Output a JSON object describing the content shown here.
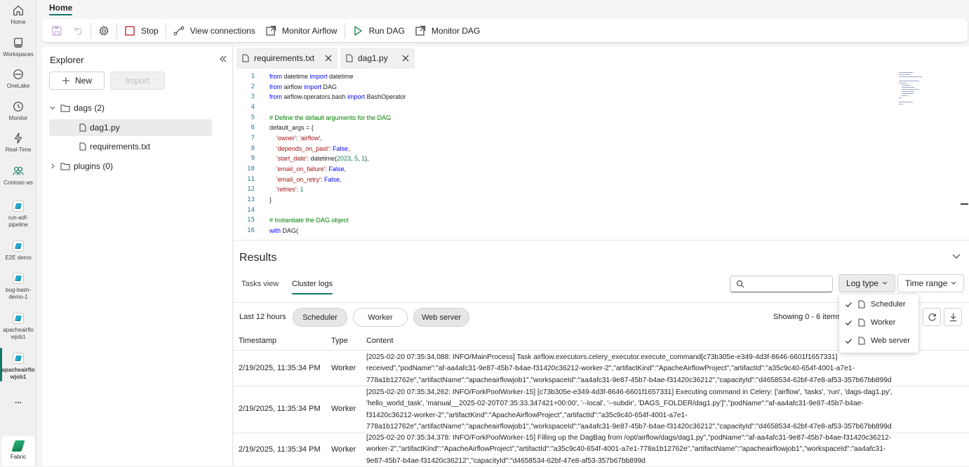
{
  "rail": {
    "items": [
      {
        "label": "Home",
        "icon": "home-icon"
      },
      {
        "label": "Workspaces",
        "icon": "workspaces-icon"
      },
      {
        "label": "OneLake",
        "icon": "onelake-icon"
      },
      {
        "label": "Monitor",
        "icon": "monitor-icon"
      },
      {
        "label": "Real-Time",
        "icon": "realtime-icon"
      },
      {
        "label": "Contoso ws",
        "icon": "workspace-group-icon"
      }
    ],
    "workspaces": [
      {
        "line1": "run-adf-",
        "line2": "pipeline"
      },
      {
        "line1": "E2E demo",
        "line2": ""
      },
      {
        "line1": "bug-bash-",
        "line2": "demo-1"
      },
      {
        "line1": "apacheairflo",
        "line2": "wjob1"
      },
      {
        "line1": "apacheairflo",
        "line2": "wjob1"
      }
    ],
    "more": "...",
    "fabric": "Fabric"
  },
  "header": {
    "home_tab": "Home"
  },
  "toolbar": {
    "stop": "Stop",
    "view_connections": "View connections",
    "monitor_airflow": "Monitor Airflow",
    "run_dag": "Run DAG",
    "monitor_dag": "Monitor DAG"
  },
  "explorer": {
    "title": "Explorer",
    "new": "New",
    "import": "Import",
    "tree": [
      {
        "label": "dags (2)"
      },
      {
        "label": "dag1.py"
      },
      {
        "label": "requirements.txt"
      },
      {
        "label": "plugins (0)"
      }
    ]
  },
  "editor": {
    "tabs": [
      {
        "label": "requirements.txt"
      },
      {
        "label": "dag1.py"
      }
    ],
    "lines": [
      "from datetime import datetime",
      "from airflow import DAG",
      "from airflow.operators.bash import BashOperator",
      "",
      "# Define the default arguments for the DAG",
      "default_args = {",
      "    'owner': 'airflow',",
      "    'depends_on_past': False,",
      "    'start_date': datetime(2023, 5, 1),",
      "    'email_on_failure': False,",
      "    'email_on_retry': False,",
      "    'retries': 1",
      "}",
      "",
      "# Instantiate the DAG object",
      "with DAG("
    ]
  },
  "results": {
    "title": "Results",
    "tabs": [
      {
        "label": "Tasks view"
      },
      {
        "label": "Cluster logs"
      }
    ],
    "log_type": "Log type",
    "time_range": "Time range",
    "filter_label": "Last 12 hours",
    "pills": [
      {
        "label": "Scheduler"
      },
      {
        "label": "Worker"
      },
      {
        "label": "Web server"
      }
    ],
    "showing": "Showing 0 - 6 items",
    "columns": {
      "timestamp": "Timestamp",
      "type": "Type",
      "content": "Content"
    },
    "rows": [
      {
        "timestamp": "2/19/2025, 11:35:34 PM",
        "type": "Worker",
        "lines": [
          "[2025-02-20 07:35:34,088: INFO/MainProcess] Task airflow.executors.celery_executor.execute_command[c73b305e-e349-4d3f-8646-6601f1657331]",
          "received\",\"podName\":\"af-aa4afc31-9e87-45b7-b4ae-f31420c36212-worker-2\",\"artifactKind\":\"ApacheAirflowProject\",\"artifactId\":\"a35c9c40-654f-4001-a7e1-",
          "778a1b12762e\",\"artifactName\":\"apacheairflowjob1\",\"workspaceId\":\"aa4afc31-9e87-45b7-b4ae-f31420c36212\",\"capacityId\":\"d4658534-62bf-47e8-af53-357b67bb899d"
        ]
      },
      {
        "timestamp": "2/19/2025, 11:35:34 PM",
        "type": "Worker",
        "lines": [
          "[2025-02-20 07:35:34,262: INFO/ForkPoolWorker-15] [c73b305e-e349-4d3f-8646-6601f1657331] Executing command in Celery: ['airflow', 'tasks', 'run', 'dags-dag1.py',",
          "'hello_world_task', 'manual__2025-02-20T07:35:33.347421+00:00', '--local', '--subdir', 'DAGS_FOLDER/dag1.py']\",\"podName\":\"af-aa4afc31-9e87-45b7-b4ae-",
          "f31420c36212-worker-2\",\"artifactKind\":\"ApacheAirflowProject\",\"artifactId\":\"a35c9c40-654f-4001-a7e1-",
          "778a1b12762e\",\"artifactName\":\"apacheairflowjob1\",\"workspaceId\":\"aa4afc31-9e87-45b7-b4ae-f31420c36212\",\"capacityId\":\"d4658534-62bf-47e8-af53-357b67bb899d"
        ]
      },
      {
        "timestamp": "2/19/2025, 11:35:34 PM",
        "type": "Worker",
        "lines": [
          "[2025-02-20 07:35:34,378: INFO/ForkPoolWorker-15] Filling up the DagBag from /opt/airflow/dags/dag1.py\",\"podName\":\"af-aa4afc31-9e87-45b7-b4ae-f31420c36212-",
          "worker-2\",\"artifactKind\":\"ApacheAirflowProject\",\"artifactId\":\"a35c9c40-654f-4001-a7e1-778a1b12762e\",\"artifactName\":\"apacheairflowjob1\",\"workspaceId\":\"aa4afc31-",
          "9e87-45b7-b4ae-f31420c36212\",\"capacityId\":\"d4658534-62bf-47e8-af53-357b67bb899d"
        ]
      }
    ],
    "log_type_menu": [
      {
        "label": "Scheduler",
        "checked": true
      },
      {
        "label": "Worker",
        "checked": true
      },
      {
        "label": "Web server",
        "checked": true
      }
    ]
  },
  "colors": {
    "accent": "#117865",
    "stop": "#c50f1f",
    "run": "#107c41"
  }
}
